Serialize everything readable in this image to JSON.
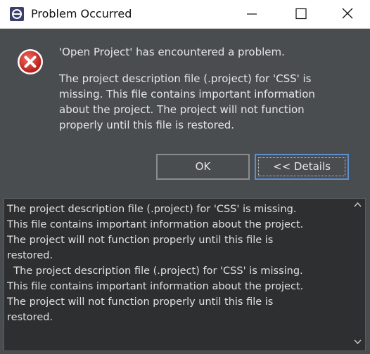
{
  "window": {
    "title": "Problem Occurred",
    "controls": {
      "minimize": "minimize-icon",
      "maximize": "maximize-icon",
      "close": "close-icon"
    }
  },
  "dialog": {
    "icon": "error-icon",
    "heading": "'Open Project' has encountered a problem.",
    "message": "The project description file (.project) for 'CSS' is missing.  This file contains important information about the project.  The project will not function properly until this file is restored."
  },
  "buttons": {
    "ok_label": "OK",
    "details_label": "<< Details"
  },
  "details": {
    "text": "The project description file (.project) for 'CSS' is missing.\nThis file contains important information about the project.\nThe project will not function properly until this file is\nrestored.\n  The project description file (.project) for 'CSS' is missing.\nThis file contains important information about the project.\nThe project will not function properly until this file is\nrestored."
  },
  "colors": {
    "background": "#4a4d50",
    "details_background": "#2e2f31",
    "error_red": "#d9342b",
    "focus_border": "#5e8fd0"
  }
}
